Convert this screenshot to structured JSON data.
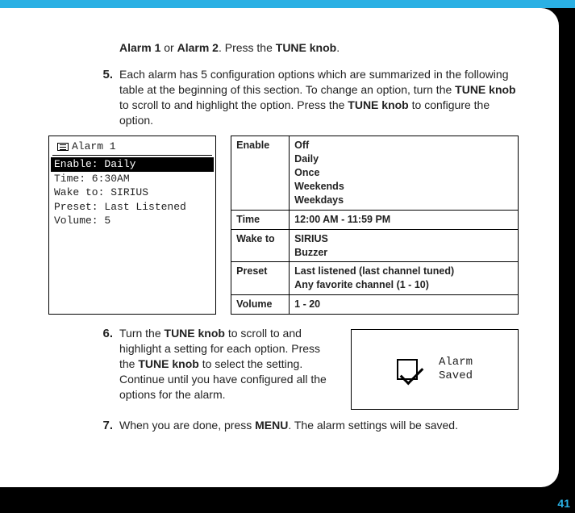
{
  "intro": {
    "pre": "Alarm 1",
    "mid": " or ",
    "post": "Alarm 2",
    "tail1": ". Press the ",
    "tune": "TUNE knob",
    "tail2": "."
  },
  "step5": {
    "num": "5.",
    "l1a": "Each alarm has 5 configuration options which are summarized in the following table at the beginning of this section. To change an option, turn the ",
    "l1b": "TUNE knob",
    "l1c": " to scroll to and highlight the option. Press the ",
    "l1d": "TUNE knob",
    "l1e": " to configure the option."
  },
  "lcd": {
    "title": "Alarm 1",
    "rows": [
      "Enable: Daily",
      "Time: 6:30AM",
      "Wake to: SIRIUS",
      "Preset: Last Listened",
      "Volume: 5"
    ],
    "hl_index": 0
  },
  "table": [
    {
      "k": "Enable",
      "v": [
        "Off",
        "Daily",
        "Once",
        "Weekends",
        "Weekdays"
      ]
    },
    {
      "k": "Time",
      "v": [
        "12:00 AM - 11:59 PM"
      ]
    },
    {
      "k": "Wake to",
      "v": [
        "SIRIUS",
        "Buzzer"
      ]
    },
    {
      "k": "Preset",
      "v": [
        "Last listened (last channel tuned)",
        "Any favorite channel (1 - 10)"
      ]
    },
    {
      "k": "Volume",
      "v": [
        "1 - 20"
      ]
    }
  ],
  "step6": {
    "num": "6.",
    "a": "Turn the ",
    "b": "TUNE knob",
    "c": " to scroll to and highlight a setting for each option. Press the ",
    "d": "TUNE knob",
    "e": " to select the setting. Continue until you have configured all the options for the alarm."
  },
  "step7": {
    "num": "7.",
    "a": "When you are done, press ",
    "b": "MENU",
    "c": ". The alarm settings will be saved."
  },
  "saved": {
    "l1": "Alarm",
    "l2": "Saved"
  },
  "page_number": "41"
}
